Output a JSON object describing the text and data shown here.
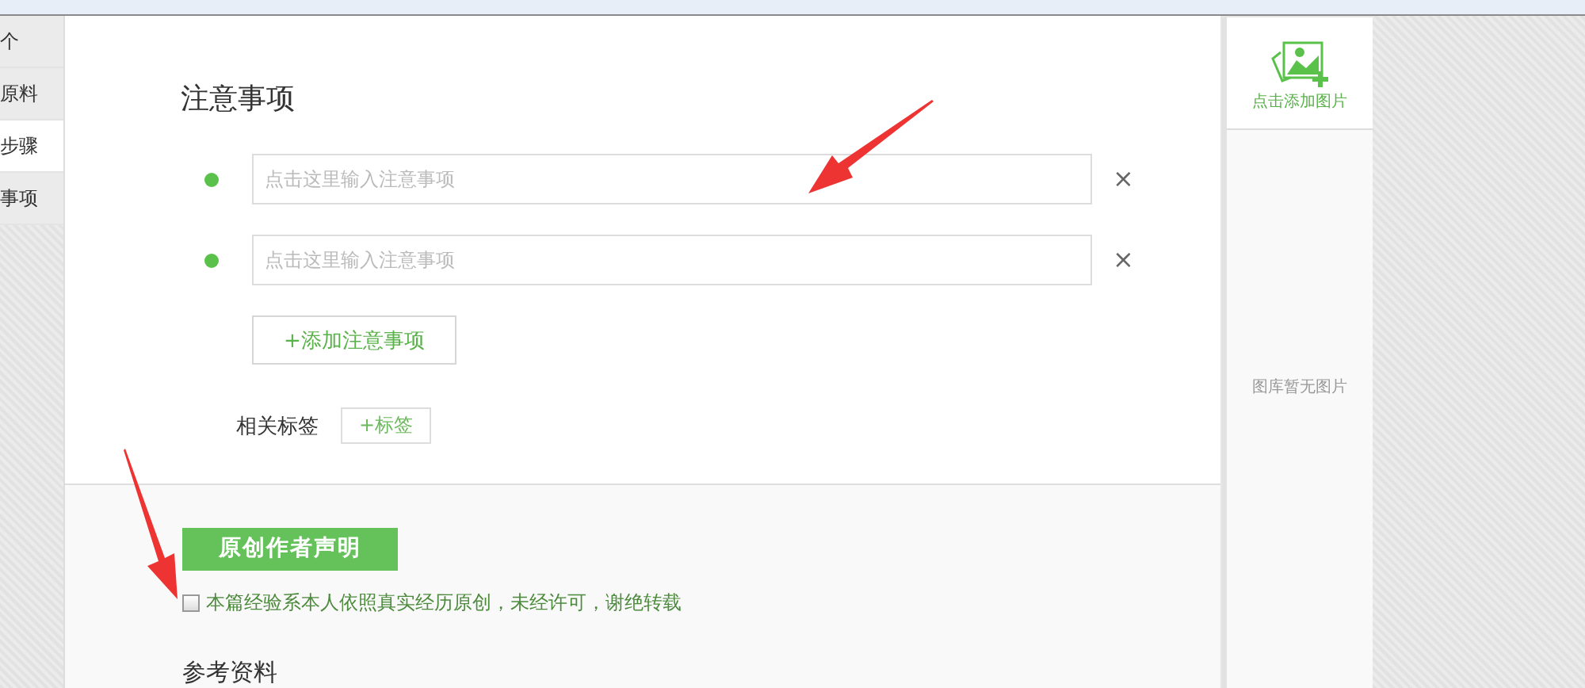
{
  "nav": {
    "items": [
      {
        "label": "个",
        "selected": false
      },
      {
        "label": "原料",
        "selected": false
      },
      {
        "label": "步骤",
        "selected": true
      },
      {
        "label": "事项",
        "selected": false
      }
    ]
  },
  "notes": {
    "title": "注意事项",
    "items": [
      {
        "placeholder": "点击这里输入注意事项",
        "remove": "×"
      },
      {
        "placeholder": "点击这里输入注意事项",
        "remove": "×"
      }
    ],
    "add_button": "+添加注意事项"
  },
  "tags": {
    "label": "相关标签",
    "button": "+标签"
  },
  "declaration": {
    "title": "原创作者声明",
    "checkbox": {
      "label": "本篇经验系本人依照真实经历原创，未经许可，谢绝转载",
      "checked": false
    }
  },
  "references": {
    "title": "参考资料"
  },
  "image_panel": {
    "add_label": "点击添加图片",
    "empty_text": "图库暂无图片"
  }
}
